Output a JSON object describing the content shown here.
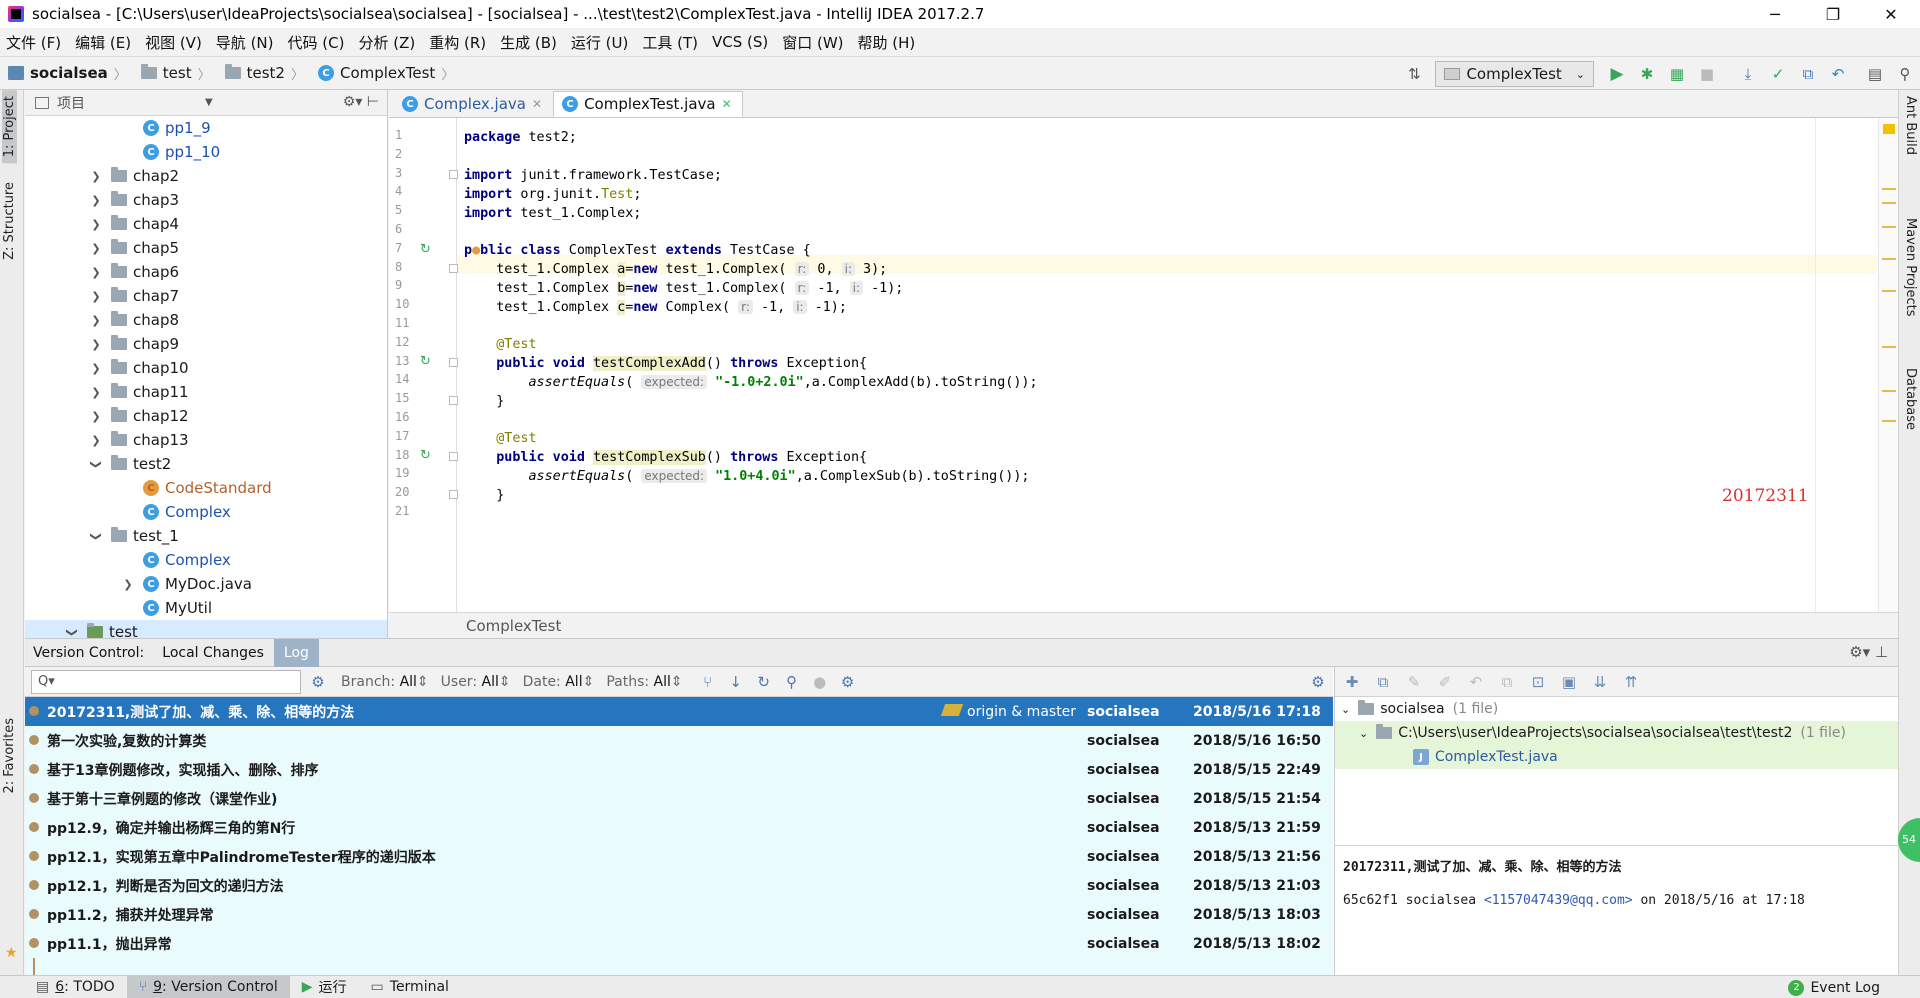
{
  "window": {
    "title": "socialsea - [C:\\Users\\user\\IdeaProjects\\socialsea\\socialsea] - [socialsea] - ...\\test\\test2\\ComplexTest.java - IntelliJ IDEA 2017.2.7",
    "minimize": "─",
    "restore": "❐",
    "close": "✕"
  },
  "menu": [
    "文件 (F)",
    "编辑 (E)",
    "视图 (V)",
    "导航 (N)",
    "代码 (C)",
    "分析 (Z)",
    "重构 (R)",
    "生成 (B)",
    "运行 (U)",
    "工具 (T)",
    "VCS (S)",
    "窗口 (W)",
    "帮助 (H)"
  ],
  "breadcrumb": [
    "socialsea",
    "test",
    "test2",
    "ComplexTest"
  ],
  "run_config": "ComplexTest",
  "left_tabs": [
    "1: Project",
    "Z: Structure",
    "2: Favorites"
  ],
  "right_tabs": [
    "Ant Build",
    "Maven Projects",
    "Database"
  ],
  "project_panel": {
    "header": "项目",
    "tree": [
      {
        "label": "pp1_9",
        "type": "class",
        "color": "blue",
        "indent": 2
      },
      {
        "label": "pp1_10",
        "type": "class",
        "color": "blue",
        "indent": 2
      },
      {
        "label": "chap2",
        "type": "folder",
        "indent": 1,
        "arrow": "›"
      },
      {
        "label": "chap3",
        "type": "folder",
        "indent": 1,
        "arrow": "›"
      },
      {
        "label": "chap4",
        "type": "folder",
        "indent": 1,
        "arrow": "›"
      },
      {
        "label": "chap5",
        "type": "folder",
        "indent": 1,
        "arrow": "›"
      },
      {
        "label": "chap6",
        "type": "folder",
        "indent": 1,
        "arrow": "›"
      },
      {
        "label": "chap7",
        "type": "folder",
        "indent": 1,
        "arrow": "›"
      },
      {
        "label": "chap8",
        "type": "folder",
        "indent": 1,
        "arrow": "›"
      },
      {
        "label": "chap9",
        "type": "folder",
        "indent": 1,
        "arrow": "›"
      },
      {
        "label": "chap10",
        "type": "folder",
        "indent": 1,
        "arrow": "›"
      },
      {
        "label": "chap11",
        "type": "folder",
        "indent": 1,
        "arrow": "›"
      },
      {
        "label": "chap12",
        "type": "folder",
        "indent": 1,
        "arrow": "›"
      },
      {
        "label": "chap13",
        "type": "folder",
        "indent": 1,
        "arrow": "›"
      },
      {
        "label": "test2",
        "type": "folder",
        "indent": 1,
        "arrow": "⌄"
      },
      {
        "label": "CodeStandard",
        "type": "class-orange",
        "color": "orange",
        "indent": 2
      },
      {
        "label": "Complex",
        "type": "class",
        "color": "blue",
        "indent": 2
      },
      {
        "label": "test_1",
        "type": "folder",
        "indent": 1,
        "arrow": "⌄"
      },
      {
        "label": "Complex",
        "type": "class",
        "color": "blue",
        "indent": 2
      },
      {
        "label": "MyDoc.java",
        "type": "class",
        "indent": 2,
        "arrow": "›"
      },
      {
        "label": "MyUtil",
        "type": "class",
        "indent": 2
      },
      {
        "label": "test",
        "type": "folder-green",
        "indent": 0,
        "arrow": "⌄"
      }
    ]
  },
  "editor": {
    "tabs": [
      {
        "label": "Complex.java",
        "active": false
      },
      {
        "label": "ComplexTest.java",
        "active": true
      }
    ],
    "line_numbers": [
      "1",
      "2",
      "3",
      "4",
      "5",
      "6",
      "7",
      "8",
      "9",
      "10",
      "11",
      "12",
      "13",
      "14",
      "15",
      "16",
      "17",
      "18",
      "19",
      "20",
      "21"
    ],
    "watermark": "20172311",
    "footer": "ComplexTest"
  },
  "version_control": {
    "title": "Version Control:",
    "tabs": [
      "Local Changes",
      "Log"
    ],
    "search_placeholder": "Q▾",
    "filters": {
      "branch_label": "Branch:",
      "branch_value": "All",
      "user_label": "User:",
      "user_value": "All",
      "date_label": "Date:",
      "date_value": "All",
      "paths_label": "Paths:",
      "paths_value": "All"
    },
    "commits": [
      {
        "message": "20172311,测试了加、减、乘、除、相等的方法",
        "branch": "origin & master",
        "author": "socialsea",
        "date": "2018/5/16 17:18",
        "selected": true
      },
      {
        "message": "第一次实验,复数的计算类",
        "branch": "",
        "author": "socialsea",
        "date": "2018/5/16 16:50"
      },
      {
        "message": "基于13章例题修改，实现插入、删除、排序",
        "branch": "",
        "author": "socialsea",
        "date": "2018/5/15 22:49"
      },
      {
        "message": "基于第十三章例题的修改（课堂作业)",
        "branch": "",
        "author": "socialsea",
        "date": "2018/5/15 21:54"
      },
      {
        "message": "pp12.9，确定并输出杨辉三角的第N行",
        "branch": "",
        "author": "socialsea",
        "date": "2018/5/13 21:59"
      },
      {
        "message": "pp12.1，实现第五章中PalindromeTester程序的递归版本",
        "branch": "",
        "author": "socialsea",
        "date": "2018/5/13 21:56"
      },
      {
        "message": "pp12.1，判断是否为回文的递归方法",
        "branch": "",
        "author": "socialsea",
        "date": "2018/5/13 21:03"
      },
      {
        "message": "pp11.2，捕获并处理异常",
        "branch": "",
        "author": "socialsea",
        "date": "2018/5/13 18:03"
      },
      {
        "message": "pp11.1，抛出异常",
        "branch": "",
        "author": "socialsea",
        "date": "2018/5/13 18:02"
      }
    ],
    "details": {
      "root": "socialsea",
      "root_count": "(1 file)",
      "path": "C:\\Users\\user\\IdeaProjects\\socialsea\\socialsea\\test\\test2",
      "path_count": "(1 file)",
      "file": "ComplexTest.java",
      "subject": "20172311,测试了加、减、乘、除、相等的方法",
      "hash": "65c62f1",
      "author": "socialsea",
      "email": "<1157047439@qq.com>",
      "on_text": "on 2018/5/16 at 17:18"
    }
  },
  "status_bar": {
    "todo_num": "6",
    "todo_label": ": TODO",
    "vc_num": "9",
    "vc_label": ": Version Control",
    "run": "运行",
    "terminal": "Terminal",
    "event_count": "2",
    "event_log": "Event Log",
    "side_badge": "54"
  }
}
